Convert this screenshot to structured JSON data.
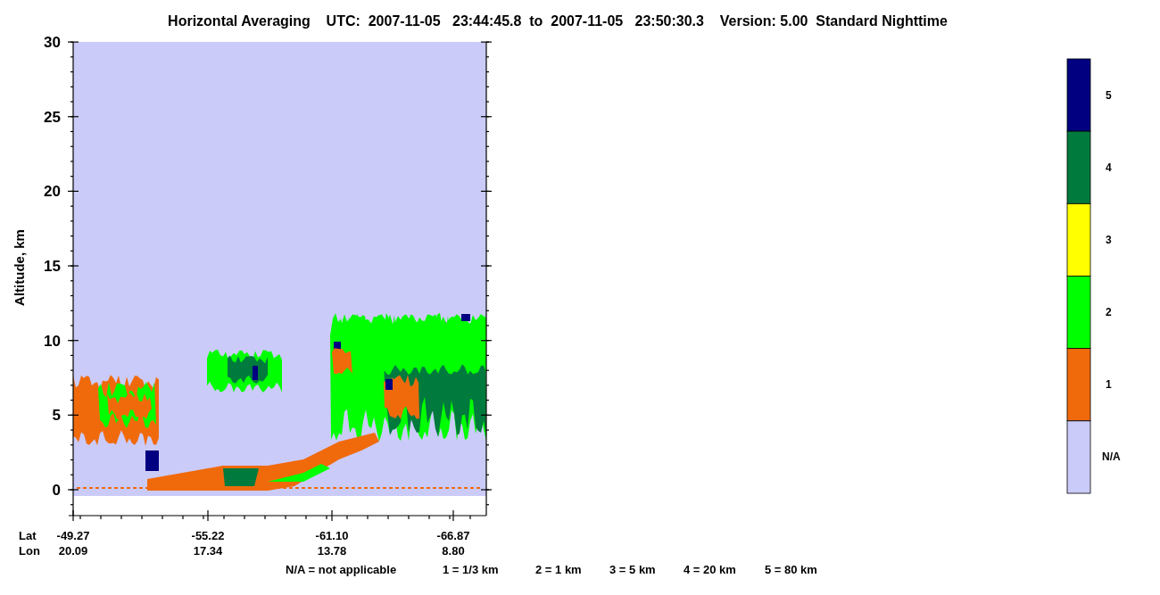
{
  "title": "Horizontal Averaging    UTC:  2007-11-05   23:44:45.8  to  2007-11-05   23:50:30.3    Version: 5.00  Standard Nighttime",
  "plot": {
    "ylabel": "Altitude, km",
    "yticks": [
      "30",
      "25",
      "20",
      "15",
      "10",
      "5",
      "0"
    ],
    "x_rows": [
      {
        "label": "Lat",
        "values": [
          "-49.27",
          "-55.22",
          "-61.10",
          "-66.87"
        ]
      },
      {
        "label": "Lon",
        "values": [
          "20.09",
          "17.34",
          "13.78",
          "8.80"
        ]
      }
    ]
  },
  "colorbar": [
    {
      "label": "5",
      "color": "#000080"
    },
    {
      "label": "4",
      "color": "#007a3d"
    },
    {
      "label": "3",
      "color": "#ffff00"
    },
    {
      "label": "2",
      "color": "#00ff00"
    },
    {
      "label": "1",
      "color": "#f06a0c"
    },
    {
      "label": "N/A",
      "color": "#cbcbfa"
    }
  ],
  "footer": [
    "N/A = not applicable",
    "1 = 1/3 km",
    "2 = 1 km",
    "3 = 5 km",
    "4 = 20 km",
    "5 = 80 km"
  ]
}
